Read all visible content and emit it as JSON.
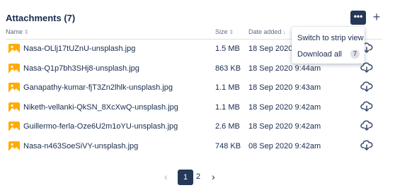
{
  "attachments": {
    "title": "Attachments (7)",
    "more_label": "•••",
    "add_label": "+"
  },
  "columns": {
    "name": "Name",
    "size": "Size",
    "date": "Date added"
  },
  "rows": [
    {
      "name": "Nasa-OLlj17tUZnU-unsplash.jpg",
      "size": "1.5 MB",
      "date": "18 Sep 2020 9:45am"
    },
    {
      "name": "Nasa-Q1p7bh3SHj8-unsplash.jpg",
      "size": "863 KB",
      "date": "18 Sep 2020 9:44am"
    },
    {
      "name": "Ganapathy-kumar-fjT3Zn2lhlk-unsplash.jpg",
      "size": "1.1 MB",
      "date": "18 Sep 2020 9:43am"
    },
    {
      "name": "Niketh-vellanki-QkSN_8XcXwQ-unsplash.jpg",
      "size": "1.1 MB",
      "date": "18 Sep 2020 9:42am"
    },
    {
      "name": "Guillermo-ferla-Oze6U2m1oYU-unsplash.jpg",
      "size": "2.6 MB",
      "date": "18 Sep 2020 9:42am"
    },
    {
      "name": "Nasa-n463SoeSiVY-unsplash.jpg",
      "size": "748 KB",
      "date": "08 Sep 2020 9:42am"
    }
  ],
  "menu": {
    "strip_view": "Switch to strip view",
    "download_all": "Download all",
    "download_count": "7"
  },
  "pagination": {
    "pages": [
      "1",
      "2"
    ],
    "current": "1"
  },
  "icons": {
    "thumbnail": "image-icon",
    "download": "cloud-download-icon",
    "sort": "sort-icon"
  },
  "colors": {
    "accent": "#253858",
    "thumbnail": "#FFAB00",
    "text": "#172B4D",
    "muted": "#5E6C84"
  }
}
